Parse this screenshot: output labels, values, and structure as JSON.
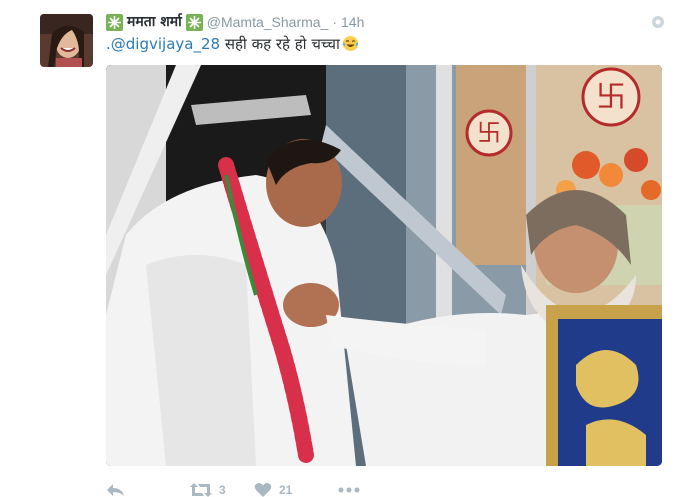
{
  "tweet": {
    "display_name": "ममता शर्मा",
    "handle": "@Mamta_Sharma_",
    "separator": "·",
    "time": "14h",
    "mention": ".@digvijaya_28",
    "body": " सही कह रहे हो चच्चा",
    "emoji": "tears-of-joy-emoji",
    "name_badge_icon": "green-leaf-icon"
  },
  "actions": {
    "reply_icon": "reply-icon",
    "retweet_icon": "retweet-icon",
    "retweet_count": "3",
    "like_icon": "heart-icon",
    "like_count": "21",
    "more_icon": "more-dots-icon"
  },
  "colors": {
    "link": "#2b7bb9",
    "muted": "#8899a6",
    "action": "#aab8c2",
    "badge_green": "#3cb371"
  }
}
